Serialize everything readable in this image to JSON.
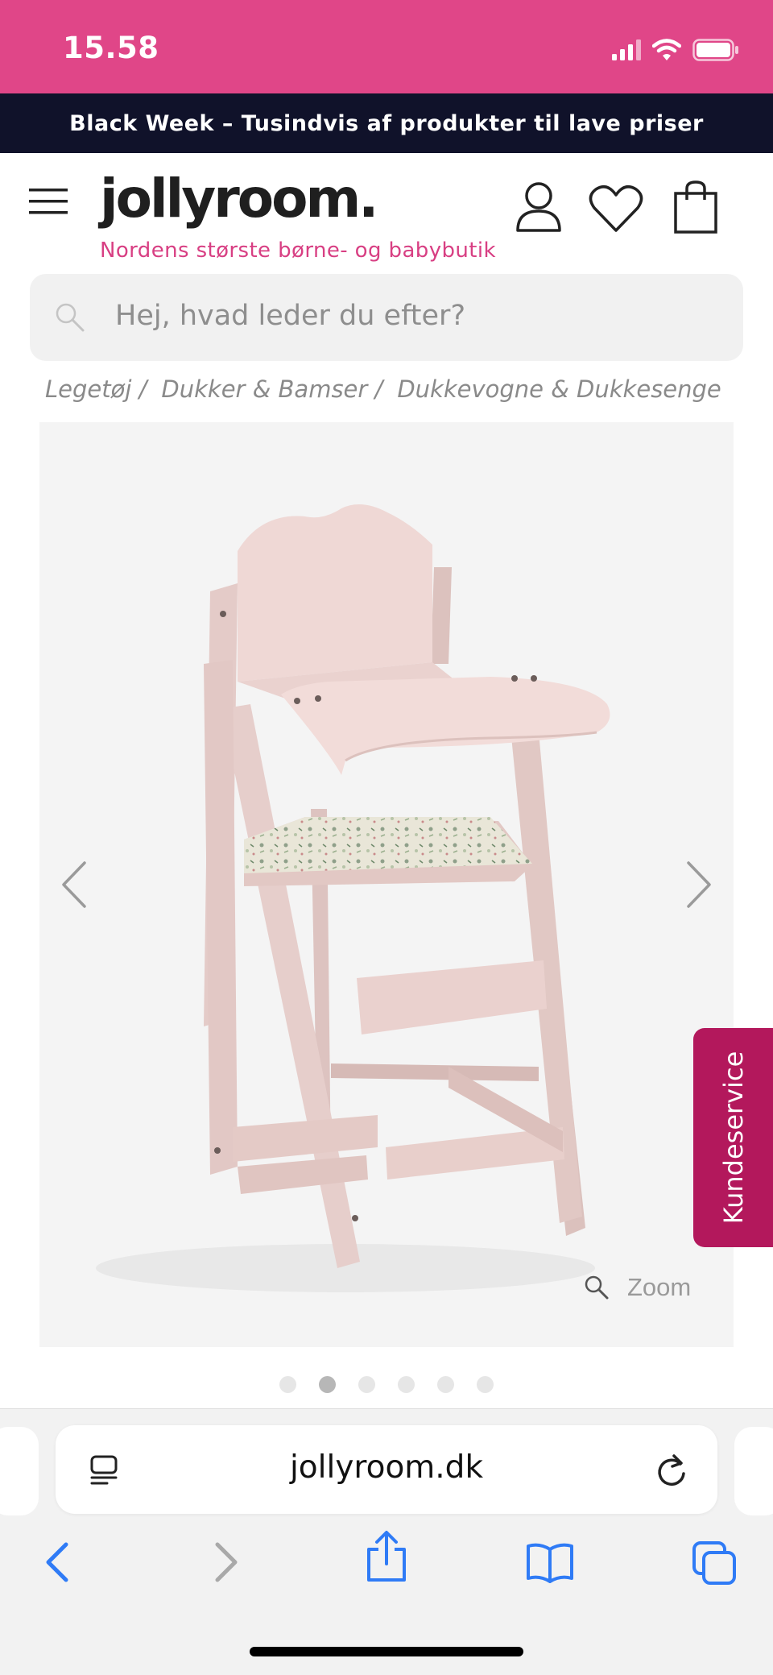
{
  "status_bar": {
    "time": "15.58",
    "color": "#e04688"
  },
  "promo": {
    "text": "Black Week – Tusindvis af produkter til lave priser"
  },
  "header": {
    "logo": "jollyroom.",
    "tagline": "Nordens største børne- og babybutik",
    "icons": [
      "menu-icon",
      "account-icon",
      "heart-icon",
      "cart-icon"
    ]
  },
  "search": {
    "placeholder": "Hej, hvad leder du efter?"
  },
  "breadcrumb": {
    "items": [
      "Legetøj /",
      "Dukker & Bamser /",
      "Dukkevogne & Dukkesenge"
    ]
  },
  "gallery": {
    "zoom_label": "Zoom",
    "image_count": 6,
    "active_index": 1
  },
  "kundeservice": {
    "label": "Kundeservice",
    "color": "#b3185c"
  },
  "browser": {
    "url": "jollyroom.dk",
    "accent": "#2f7bf6"
  }
}
